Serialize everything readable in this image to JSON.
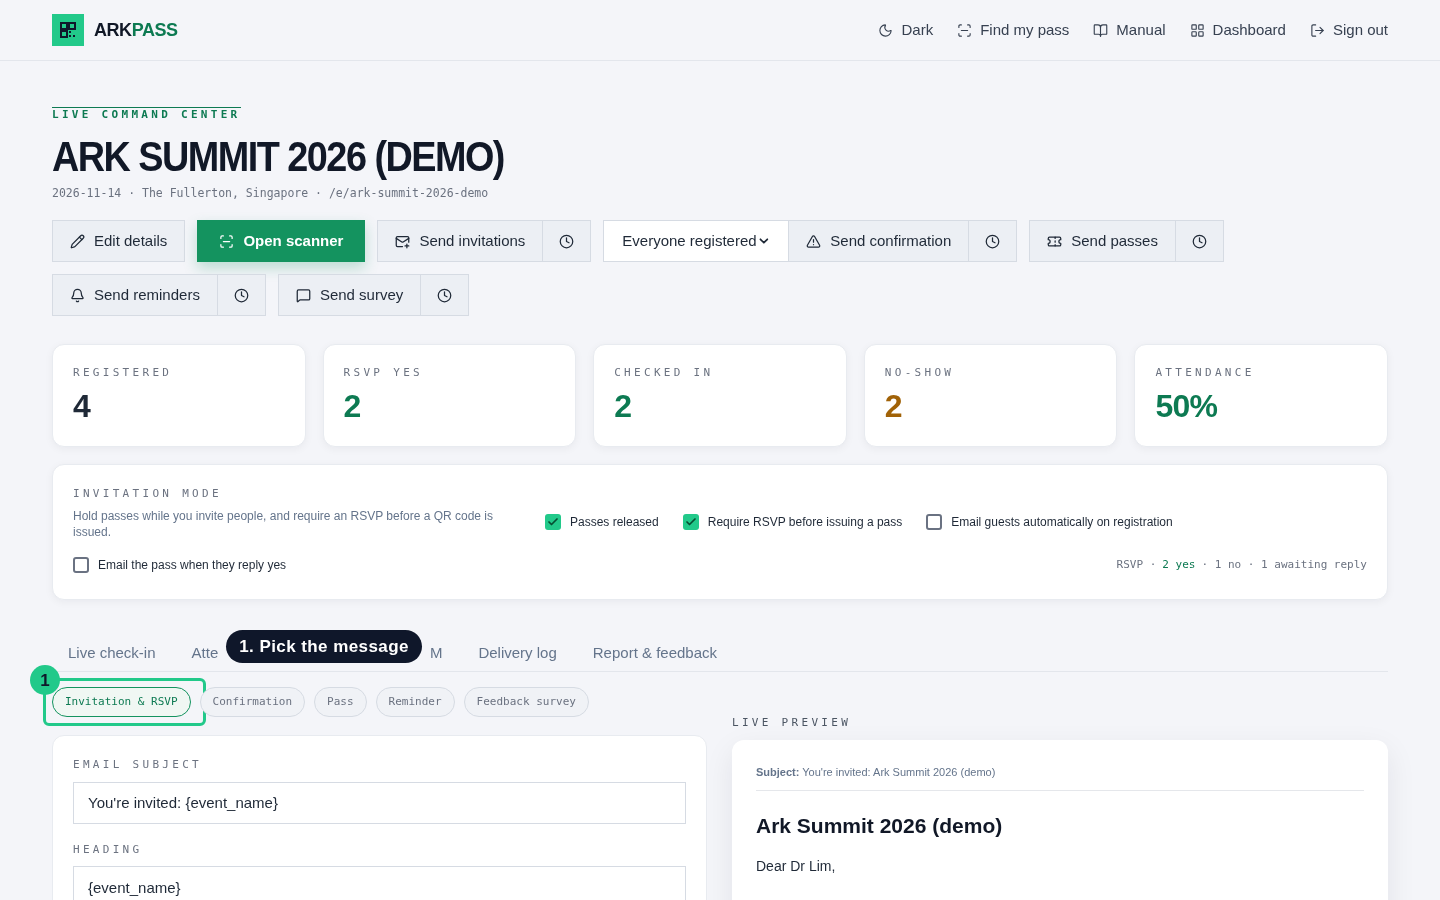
{
  "header": {
    "logo": {
      "first": "ARK",
      "second": "PASS"
    },
    "nav": [
      {
        "label": "Dark"
      },
      {
        "label": "Find my pass"
      },
      {
        "label": "Manual"
      },
      {
        "label": "Dashboard"
      },
      {
        "label": "Sign out"
      }
    ]
  },
  "eyebrow": "LIVE COMMAND CENTER",
  "title": "ARK SUMMIT 2026 (DEMO)",
  "meta": "2026-11-14 · The Fullerton, Singapore · /e/ark-summit-2026-demo",
  "action_groups": [
    {
      "items": [
        {
          "kind": "button",
          "label": "Edit details"
        }
      ]
    },
    {
      "items": [
        {
          "kind": "primary",
          "label": "Open scanner"
        }
      ]
    },
    {
      "items": [
        {
          "kind": "button",
          "label": "Send invitations"
        },
        {
          "kind": "schedule"
        }
      ]
    },
    {
      "items": [
        {
          "kind": "select",
          "value": "Everyone registered"
        },
        {
          "kind": "button",
          "label": "Send confirmation"
        },
        {
          "kind": "schedule"
        }
      ]
    },
    {
      "items": [
        {
          "kind": "button",
          "label": "Send passes"
        },
        {
          "kind": "schedule"
        }
      ]
    },
    {
      "items": [
        {
          "kind": "button",
          "label": "Send reminders"
        },
        {
          "kind": "schedule"
        }
      ]
    },
    {
      "items": [
        {
          "kind": "button",
          "label": "Send survey"
        },
        {
          "kind": "schedule"
        }
      ]
    }
  ],
  "stats": [
    {
      "label": "REGISTERED",
      "value": "4",
      "color": "#1f2937"
    },
    {
      "label": "RSVP YES",
      "value": "2",
      "color": "#0d7a52"
    },
    {
      "label": "CHECKED IN",
      "value": "2",
      "color": "#0d7a52"
    },
    {
      "label": "NO-SHOW",
      "value": "2",
      "color": "#a16207"
    },
    {
      "label": "ATTENDANCE",
      "value": "50%",
      "color": "#0d7a52"
    }
  ],
  "invitation_mode": {
    "label": "INVITATION MODE",
    "description": "Hold passes while you invite people, and require an RSVP before a QR code is issued.",
    "options": [
      {
        "label": "Passes released",
        "checked": true
      },
      {
        "label": "Require RSVP before issuing a pass",
        "checked": true
      },
      {
        "label": "Email guests automatically on registration",
        "checked": false
      }
    ],
    "extra_option": {
      "label": "Email the pass when they reply yes",
      "checked": false
    },
    "rsvp_summary": [
      {
        "text": "RSVP ·",
        "highlight": false
      },
      {
        "text": "2 yes",
        "highlight": true
      },
      {
        "text": "· 1 no · 1 awaiting reply",
        "highlight": false
      }
    ]
  },
  "tabs": [
    {
      "label": "Live check-in",
      "selected": false
    },
    {
      "label": "Atte",
      "selected": false
    },
    {
      "label": "M",
      "selected": false
    },
    {
      "label": "Delivery log",
      "selected": false
    },
    {
      "label": "Report & feedback",
      "selected": false
    }
  ],
  "message_types": [
    {
      "label": "Invitation & RSVP",
      "selected": true
    },
    {
      "label": "Confirmation",
      "selected": false
    },
    {
      "label": "Pass",
      "selected": false
    },
    {
      "label": "Reminder",
      "selected": false
    },
    {
      "label": "Feedback survey",
      "selected": false
    }
  ],
  "tour": {
    "step": "1",
    "text": "1. Pick the message"
  },
  "editor": {
    "fields": [
      {
        "label": "EMAIL SUBJECT",
        "value": "You're invited: {event_name}"
      },
      {
        "label": "HEADING",
        "value": "{event_name}"
      }
    ]
  },
  "preview": {
    "label": "LIVE PREVIEW",
    "subject_label": "Subject:",
    "subject": "You're invited: Ark Summit 2026 (demo)",
    "heading": "Ark Summit 2026 (demo)",
    "body": "Dear Dr Lim,"
  }
}
